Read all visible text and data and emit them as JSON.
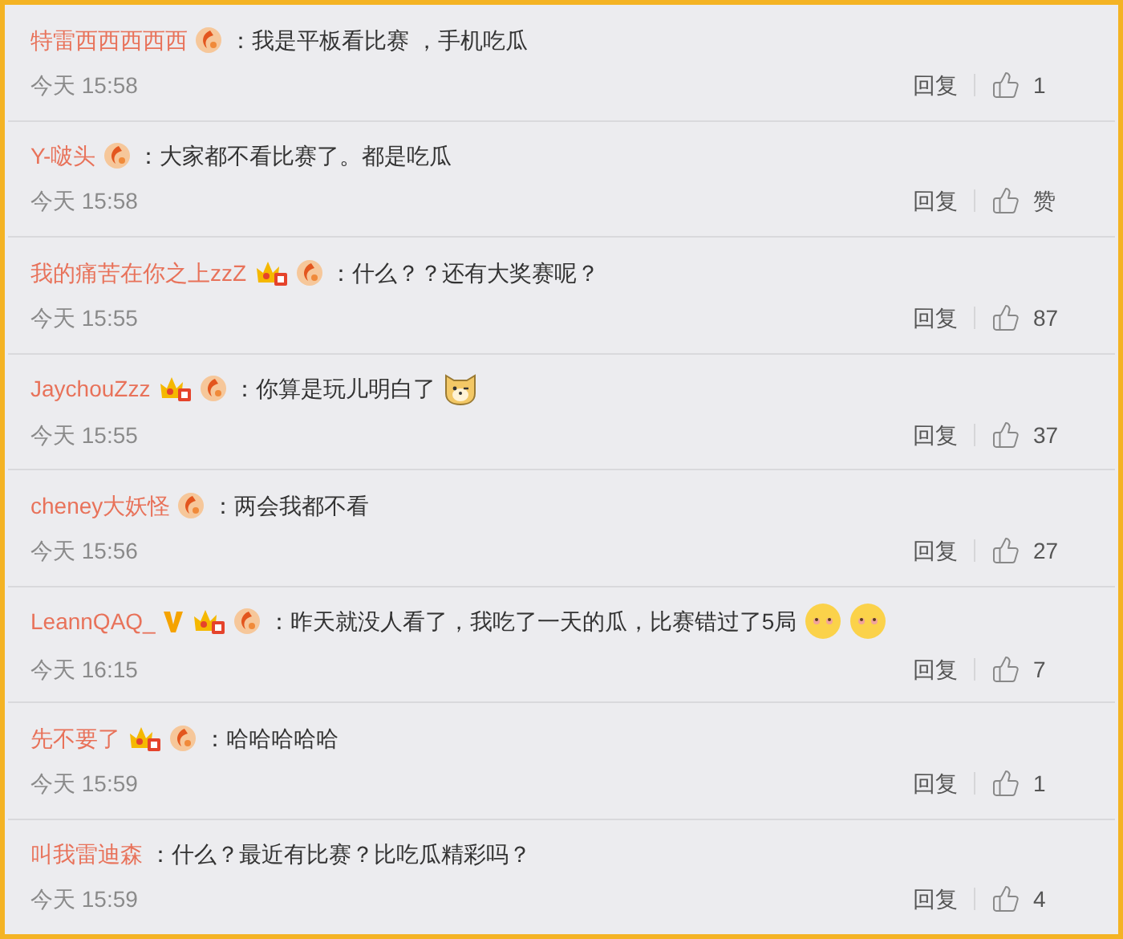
{
  "comments": [
    {
      "user": "特雷西西西西西",
      "badges": [
        {
          "kind": "medal"
        }
      ],
      "text": "：我是平板看比赛 ，手机吃瓜",
      "time": "今天 15:58",
      "reply": "回复",
      "likes": "1"
    },
    {
      "user": "Y-啵头",
      "badges": [
        {
          "kind": "medal"
        }
      ],
      "text": "：大家都不看比赛了。都是吃瓜",
      "time": "今天 15:58",
      "reply": "回复",
      "likes": "赞"
    },
    {
      "user": "我的痛苦在你之上zzZ",
      "badges": [
        {
          "kind": "crown"
        },
        {
          "kind": "medal"
        }
      ],
      "text": "：什么？？还有大奖赛呢？",
      "time": "今天 15:55",
      "reply": "回复",
      "likes": "87"
    },
    {
      "user": "JaychouZzz",
      "badges": [
        {
          "kind": "crown"
        },
        {
          "kind": "medal"
        }
      ],
      "text": "：你算是玩儿明白了",
      "emojis": [
        {
          "kind": "dog"
        }
      ],
      "time": "今天 15:55",
      "reply": "回复",
      "likes": "37"
    },
    {
      "user": "cheney大妖怪",
      "badges": [
        {
          "kind": "medal"
        }
      ],
      "text": "：两会我都不看",
      "time": "今天 15:56",
      "reply": "回复",
      "likes": "27"
    },
    {
      "user": "LeannQAQ_",
      "badges": [
        {
          "kind": "vip"
        },
        {
          "kind": "crown"
        },
        {
          "kind": "medal"
        }
      ],
      "text": "：昨天就没人看了，我吃了一天的瓜，比赛错过了5局",
      "emojis": [
        {
          "kind": "blush"
        },
        {
          "kind": "blush"
        }
      ],
      "time": "今天 16:15",
      "reply": "回复",
      "likes": "7"
    },
    {
      "user": "先不要了",
      "badges": [
        {
          "kind": "crown"
        },
        {
          "kind": "medal"
        }
      ],
      "text": "：哈哈哈哈哈",
      "time": "今天 15:59",
      "reply": "回复",
      "likes": "1"
    },
    {
      "user": "叫我雷迪森",
      "text": "：什么？最近有比赛？比吃瓜精彩吗？",
      "time": "今天 15:59",
      "reply": "回复",
      "likes": "4"
    }
  ]
}
